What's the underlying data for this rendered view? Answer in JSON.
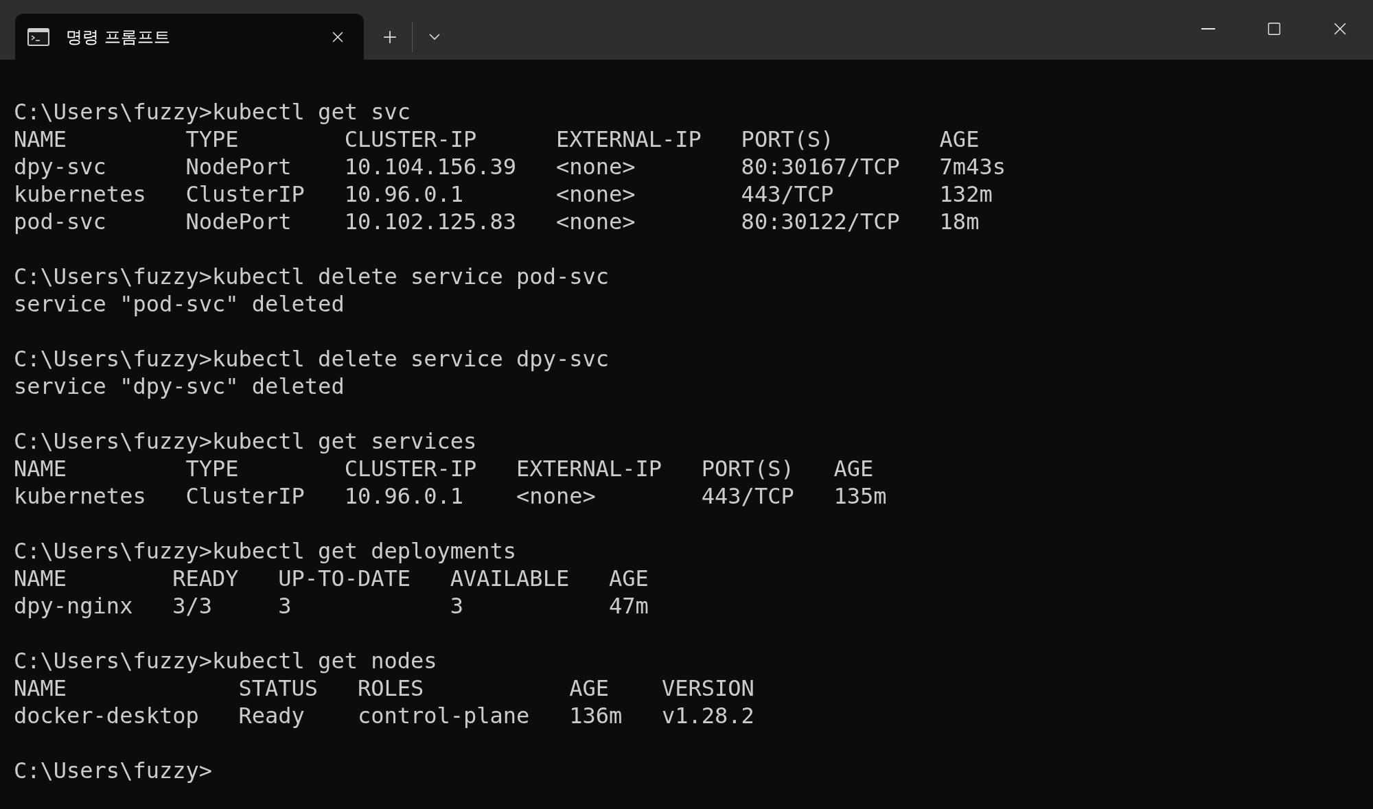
{
  "window": {
    "tab": {
      "title": "명령 프롬프트",
      "selected": true
    }
  },
  "blocks": [
    {
      "lines": [
        "C:\\Users\\fuzzy>kubectl get svc",
        "NAME         TYPE        CLUSTER-IP      EXTERNAL-IP   PORT(S)        AGE",
        "dpy-svc      NodePort    10.104.156.39   <none>        80:30167/TCP   7m43s",
        "kubernetes   ClusterIP   10.96.0.1       <none>        443/TCP        132m",
        "pod-svc      NodePort    10.102.125.83   <none>        80:30122/TCP   18m"
      ]
    },
    {
      "lines": [
        "C:\\Users\\fuzzy>kubectl delete service pod-svc",
        "service \"pod-svc\" deleted"
      ]
    },
    {
      "lines": [
        "C:\\Users\\fuzzy>kubectl delete service dpy-svc",
        "service \"dpy-svc\" deleted"
      ]
    },
    {
      "lines": [
        "C:\\Users\\fuzzy>kubectl get services",
        "NAME         TYPE        CLUSTER-IP   EXTERNAL-IP   PORT(S)   AGE",
        "kubernetes   ClusterIP   10.96.0.1    <none>        443/TCP   135m"
      ]
    },
    {
      "lines": [
        "C:\\Users\\fuzzy>kubectl get deployments",
        "NAME        READY   UP-TO-DATE   AVAILABLE   AGE",
        "dpy-nginx   3/3     3            3           47m"
      ]
    },
    {
      "lines": [
        "C:\\Users\\fuzzy>kubectl get nodes",
        "NAME             STATUS   ROLES           AGE    VERSION",
        "docker-desktop   Ready    control-plane   136m   v1.28.2"
      ]
    },
    {
      "lines": [
        "C:\\Users\\fuzzy>"
      ]
    }
  ]
}
